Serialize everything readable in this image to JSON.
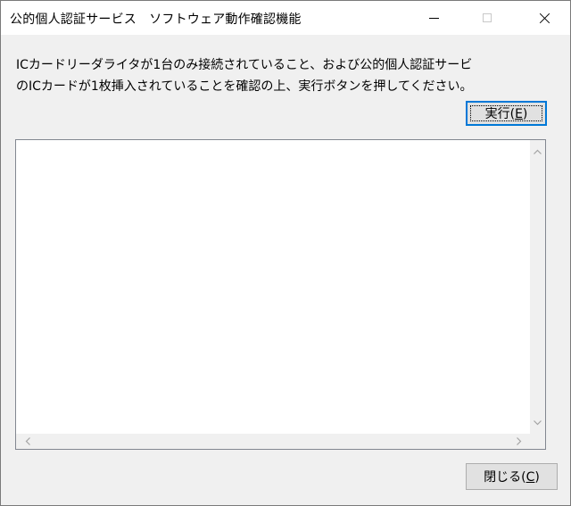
{
  "window": {
    "title": "公的個人認証サービス　ソフトウェア動作確認機能"
  },
  "instruction": {
    "line1": "ICカードリーダライタが1台のみ接続されていること、および公的個人認証サービ",
    "line2": "のICカードが1枚挿入されていることを確認の上、実行ボタンを押してください。"
  },
  "buttons": {
    "execute": {
      "label": "実行(",
      "mnemonic": "E",
      "suffix": ")"
    },
    "close": {
      "label": "閉じる(",
      "mnemonic": "C",
      "suffix": ")"
    }
  },
  "results": {
    "text": ""
  },
  "icons": {
    "minimize": "minimize-icon",
    "maximize": "maximize-icon",
    "close": "close-icon"
  },
  "colors": {
    "focus": "#0078d7",
    "window_bg": "#f0f0f0",
    "titlebar_bg": "#ffffff"
  }
}
